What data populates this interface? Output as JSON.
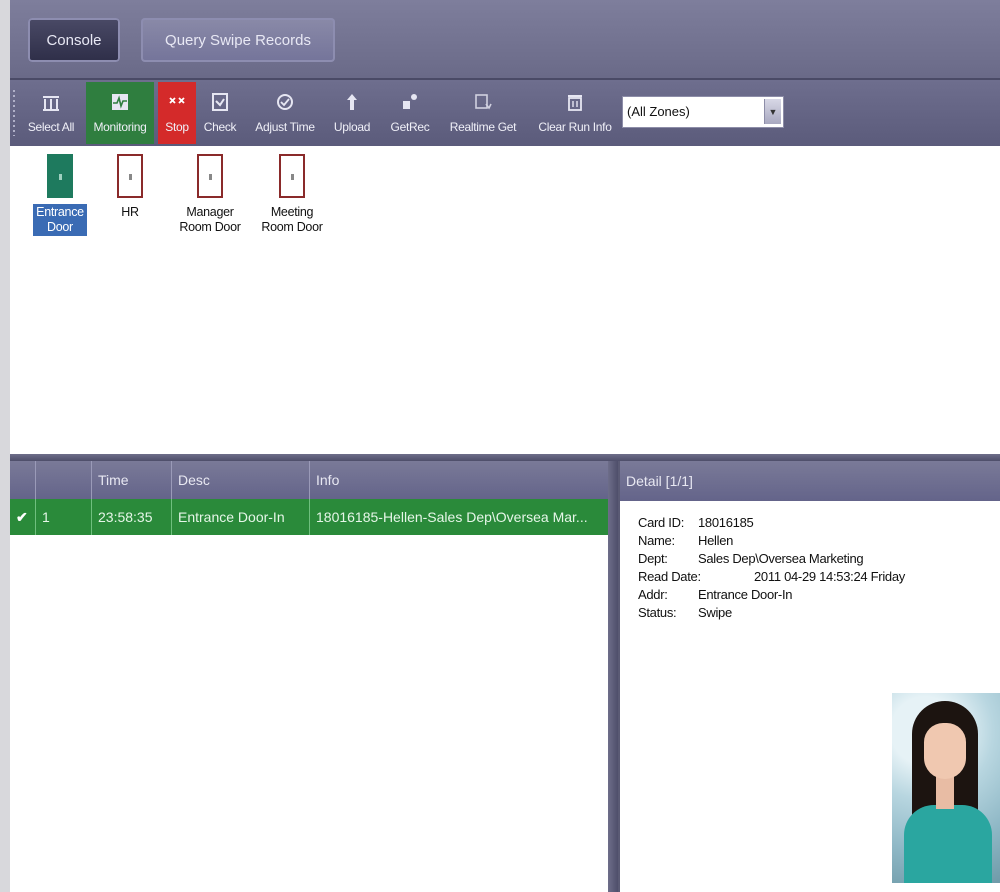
{
  "top_tabs": {
    "console": "Console",
    "query": "Query Swipe Records"
  },
  "toolbar": {
    "items": [
      {
        "label": "Select All",
        "icon": "select-all-icon"
      },
      {
        "label": "Monitoring",
        "icon": "monitoring-icon",
        "state": "active"
      },
      {
        "label": "Stop",
        "icon": "stop-icon",
        "state": "alert"
      },
      {
        "label": "Check",
        "icon": "check-icon"
      },
      {
        "label": "Adjust Time",
        "icon": "clock-icon"
      },
      {
        "label": "Upload",
        "icon": "upload-arrow-icon"
      },
      {
        "label": "GetRec",
        "icon": "get-records-icon"
      },
      {
        "label": "Realtime Get",
        "icon": "realtime-get-icon"
      },
      {
        "label": "Clear Run Info",
        "icon": "trash-icon"
      }
    ],
    "zone_value": "(All Zones)"
  },
  "doors": [
    {
      "name_line1": "Entrance",
      "name_line2": "Door",
      "status": "open",
      "selected": true
    },
    {
      "name_line1": "HR",
      "name_line2": "",
      "status": "closed",
      "selected": false
    },
    {
      "name_line1": "Manager",
      "name_line2": "Room Door",
      "status": "closed",
      "selected": false
    },
    {
      "name_line1": "Meeting",
      "name_line2": "Room Door",
      "status": "closed",
      "selected": false
    }
  ],
  "records": {
    "columns": [
      "",
      "",
      "Time",
      "Desc",
      "Info"
    ],
    "rows": [
      {
        "check": "✔",
        "num": "1",
        "time": "23:58:35",
        "desc": "Entrance Door-In",
        "info": "18016185-Hellen-Sales Dep\\Oversea Mar..."
      }
    ]
  },
  "detail": {
    "header": "Detail [1/1]",
    "fields": [
      {
        "label": "Card ID:",
        "value": "18016185"
      },
      {
        "label": "Name:",
        "value": "Hellen"
      },
      {
        "label": "Dept:",
        "value": "Sales Dep\\Oversea Marketing"
      },
      {
        "label": "Read Date:",
        "value": "2011 04-29 14:53:24 Friday"
      },
      {
        "label": "Addr:",
        "value": "Entrance Door-In"
      },
      {
        "label": "Status:",
        "value": "Swipe"
      }
    ]
  },
  "colors": {
    "toolbar_bg": "#6e6e8e",
    "monitoring_green": "#2f7e3f",
    "stop_red": "#d42a2a",
    "row_green": "#2a8a3a",
    "selected_blue": "#3a6bb4"
  }
}
